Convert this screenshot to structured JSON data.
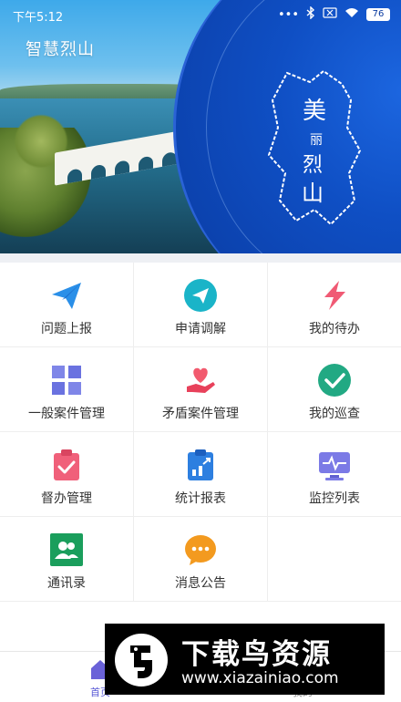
{
  "status_bar": {
    "time": "下午5:12",
    "battery": "76"
  },
  "header": {
    "app_name": "智慧烈山",
    "banner_map_text": "美丽烈山"
  },
  "grid": [
    [
      {
        "label": "问题上报",
        "icon": "paper-plane-icon"
      },
      {
        "label": "申请调解",
        "icon": "send-circle-icon"
      },
      {
        "label": "我的待办",
        "icon": "lightning-icon"
      }
    ],
    [
      {
        "label": "一般案件管理",
        "icon": "grid-squares-icon"
      },
      {
        "label": "矛盾案件管理",
        "icon": "heart-hand-icon"
      },
      {
        "label": "我的巡查",
        "icon": "check-circle-icon"
      }
    ],
    [
      {
        "label": "督办管理",
        "icon": "clipboard-check-icon"
      },
      {
        "label": "统计报表",
        "icon": "report-icon"
      },
      {
        "label": "监控列表",
        "icon": "monitor-icon"
      }
    ],
    [
      {
        "label": "通讯录",
        "icon": "contacts-icon"
      },
      {
        "label": "消息公告",
        "icon": "chat-bubble-icon"
      }
    ]
  ],
  "tabbar": {
    "home": "首页",
    "mine": "我的"
  },
  "watermark": {
    "title": "下载鸟资源",
    "url": "www.xiazainiao.com"
  },
  "colors": {
    "banner_blue": "#0f4fc4",
    "tab_active": "#5a5ad6"
  }
}
